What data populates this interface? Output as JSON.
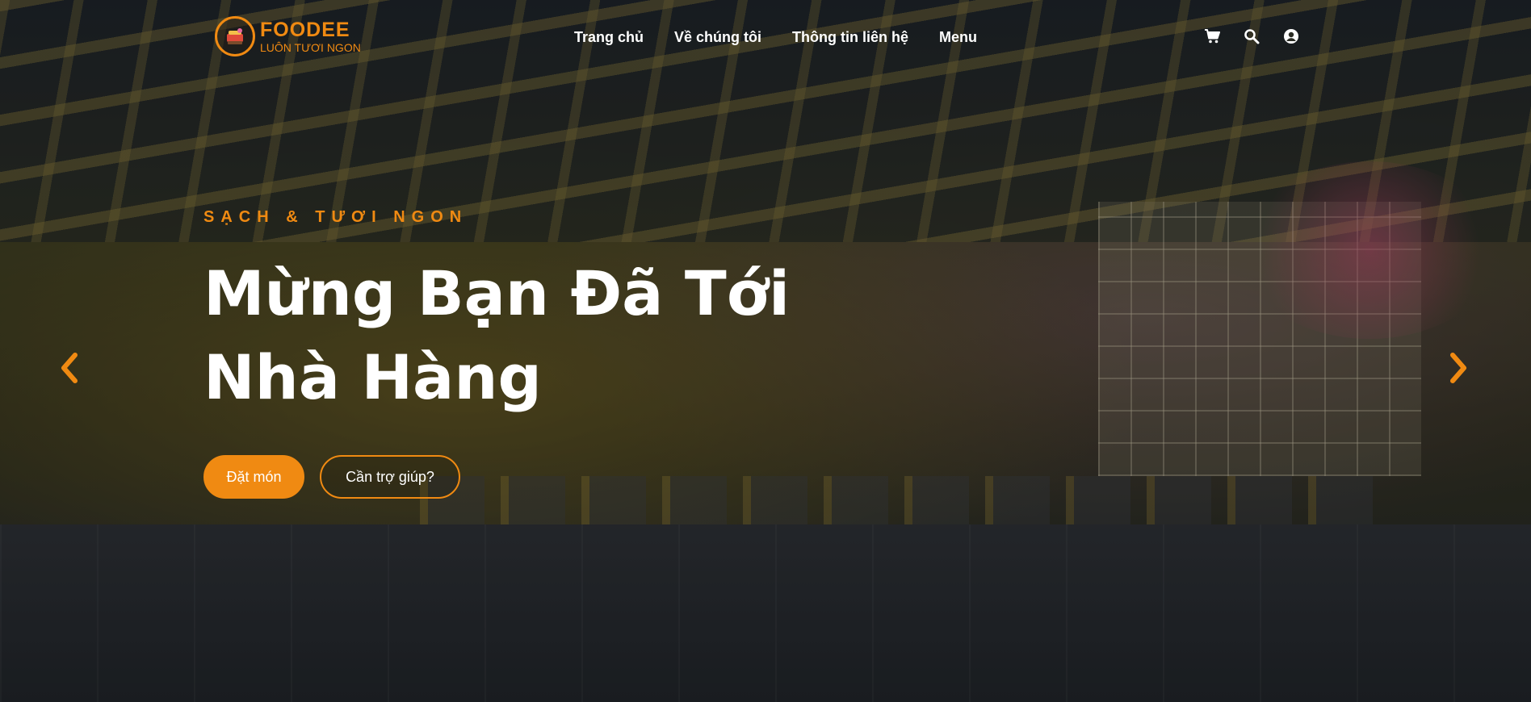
{
  "brand": {
    "name": "FOODEE",
    "tagline": "LUÔN TƯƠI NGON",
    "accent_color": "#f08a12"
  },
  "nav": {
    "items": [
      {
        "label": "Trang chủ"
      },
      {
        "label": "Về chúng tôi"
      },
      {
        "label": "Thông tin liên hệ"
      },
      {
        "label": "Menu"
      }
    ]
  },
  "header_icons": [
    "cart-icon",
    "search-icon",
    "user-account-icon"
  ],
  "hero": {
    "eyebrow": "SẠCH & TƯƠI NGON",
    "headline_line1": "Mừng Bạn Đã Tới",
    "headline_line2": "Nhà Hàng",
    "primary_button": "Đặt món",
    "secondary_button": "Cần trợ giúp?"
  },
  "carousel": {
    "prev_icon": "chevron-left-icon",
    "next_icon": "chevron-right-icon"
  }
}
